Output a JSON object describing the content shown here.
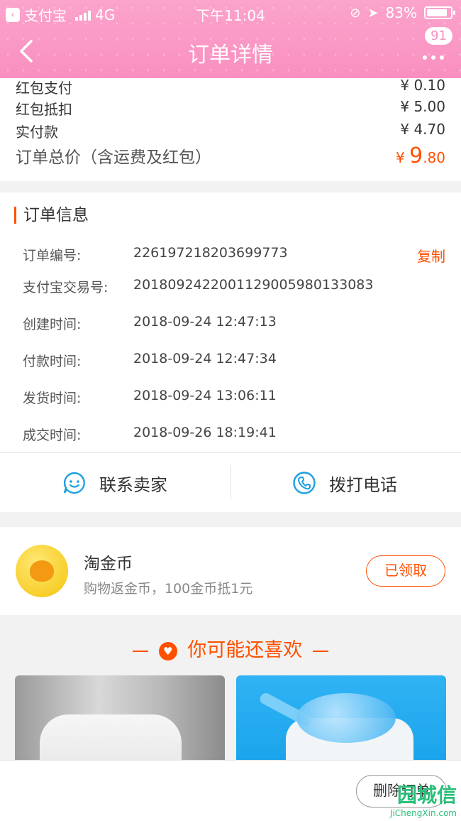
{
  "status_bar": {
    "carrier": "支付宝",
    "network": "4G",
    "time": "下午11:04",
    "battery": "83%"
  },
  "nav": {
    "title": "订单详情",
    "badge": "91"
  },
  "price": {
    "rows": [
      {
        "label": "红包支付",
        "value": "¥ 0.10"
      },
      {
        "label": "红包抵扣",
        "value": "¥ 5.00"
      },
      {
        "label": "实付款",
        "value": "¥ 4.70"
      }
    ],
    "total_label": "订单总价（含运费及红包）",
    "total_symbol": "¥ ",
    "total_int": "9",
    "total_dec": ".80"
  },
  "order_info": {
    "title": "订单信息",
    "copy_label": "复制",
    "rows": [
      {
        "label": "订单编号:",
        "value": "226197218203699773"
      },
      {
        "label": "支付宝交易号:",
        "value": "2018092422001129005980133083"
      },
      {
        "label": "创建时间:",
        "value": "2018-09-24 12:47:13"
      },
      {
        "label": "付款时间:",
        "value": "2018-09-24 12:47:34"
      },
      {
        "label": "发货时间:",
        "value": "2018-09-24 13:06:11"
      },
      {
        "label": "成交时间:",
        "value": "2018-09-26 18:19:41"
      }
    ],
    "contact_seller": "联系卖家",
    "call_phone": "拨打电话"
  },
  "coin": {
    "title": "淘金币",
    "subtitle": "购物返金币，100金币抵1元",
    "button": "已领取"
  },
  "recommend": {
    "title": "你可能还喜欢"
  },
  "bottom": {
    "delete_order": "删除订单"
  },
  "watermark": {
    "brand": "园城信",
    "url": "JiChengXin.com"
  },
  "colors": {
    "header": "#f98fbf",
    "accent": "#ff5000",
    "icon_blue": "#1e9fe3"
  }
}
